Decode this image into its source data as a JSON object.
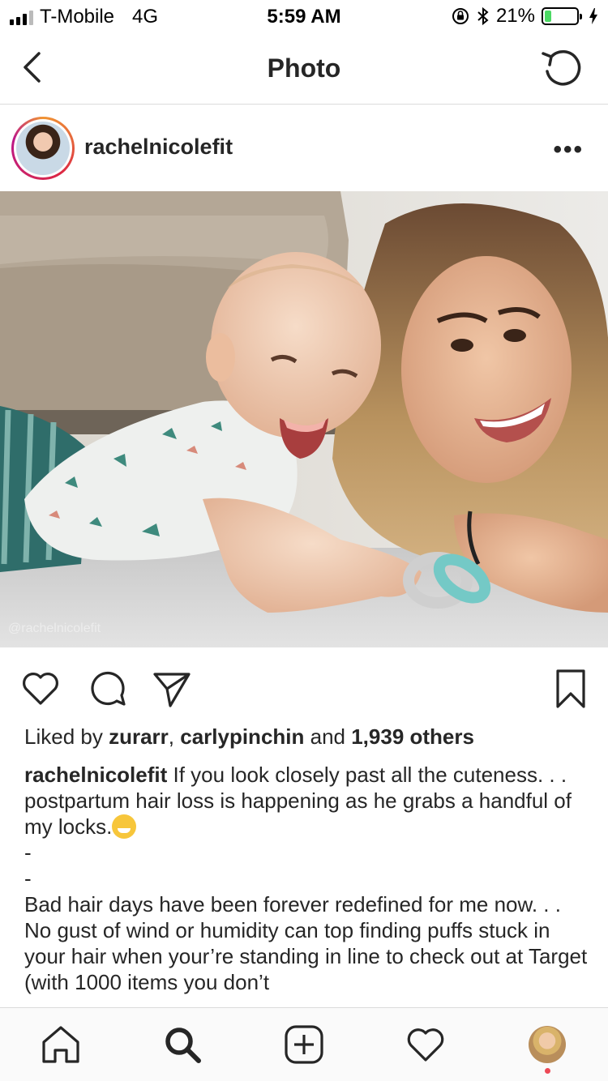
{
  "status_bar": {
    "carrier": "T-Mobile",
    "network": "4G",
    "time": "5:59 AM",
    "battery_percent": "21%",
    "battery_level": 0.21,
    "icons": [
      "signal-icon",
      "lock-rotation-icon",
      "bluetooth-icon",
      "battery-icon",
      "charging-icon"
    ]
  },
  "nav": {
    "title": "Photo",
    "back_icon": "chevron-left-icon",
    "refresh_icon": "refresh-icon"
  },
  "post": {
    "username": "rachelnicolefit",
    "more_icon": "more-icon",
    "watermark": "@rachelnicolefit",
    "actions": [
      "heart-icon",
      "comment-icon",
      "share-icon",
      "bookmark-icon"
    ],
    "likes": {
      "prefix": "Liked by ",
      "user1": "zurarr",
      "separator": ", ",
      "user2": "carlypinchin",
      "middle": " and ",
      "others": "1,939 others"
    },
    "caption": {
      "username": "rachelnicolefit",
      "line1": " If you look closely past all the cuteness. . . postpartum hair loss is happening as he grabs a handful of my locks.",
      "dash1": "-",
      "dash2": "-",
      "line2": "Bad hair days have been forever redefined for me now. . . No gust of wind or humidity can top finding puffs stuck in your hair when your’re standing in line to check out at Target (with 1000 items you don’t"
    }
  },
  "tab_bar": {
    "items": [
      "home-icon",
      "search-icon",
      "add-icon",
      "activity-icon",
      "profile-avatar"
    ]
  },
  "colors": {
    "accent_red": "#ed4956",
    "battery_green": "#4cd964",
    "divider": "#dbdbdb"
  }
}
